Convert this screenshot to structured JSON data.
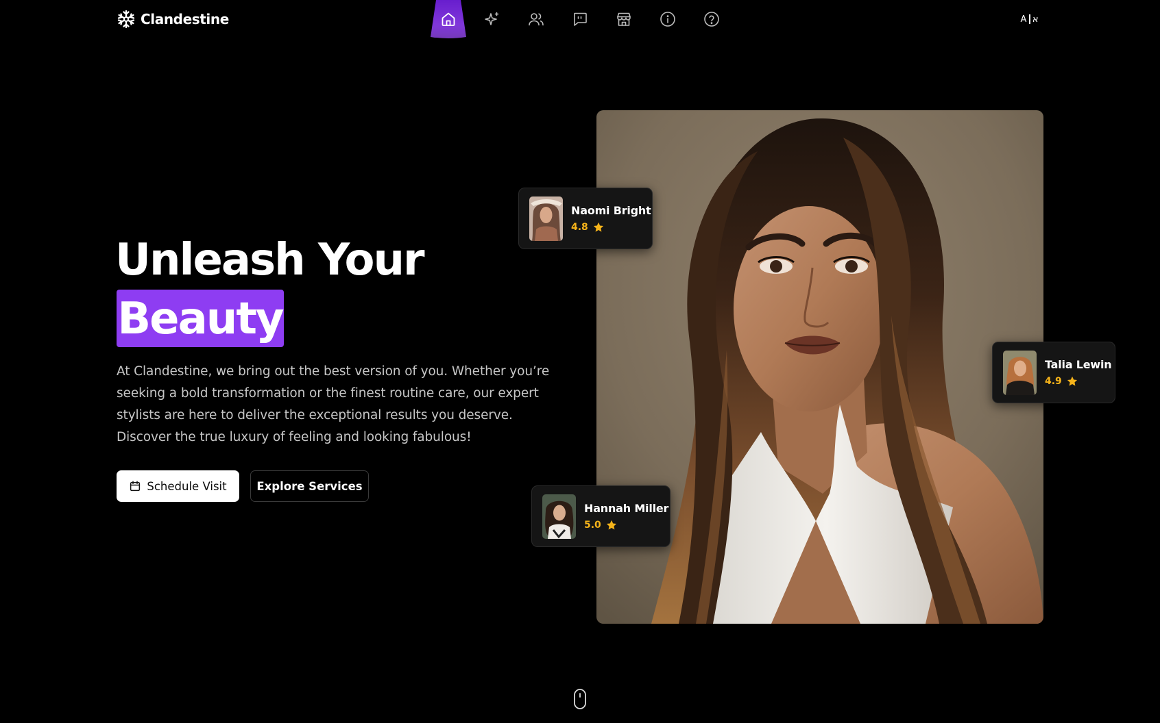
{
  "brand": {
    "name": "Clandestine",
    "logo_icon": "snowflake-icon"
  },
  "nav": {
    "active_index": 0,
    "accent_color": "#8e3df2",
    "items": [
      {
        "icon": "home-icon"
      },
      {
        "icon": "sparkles-icon"
      },
      {
        "icon": "users-icon"
      },
      {
        "icon": "quote-chat-icon"
      },
      {
        "icon": "store-icon"
      },
      {
        "icon": "info-icon"
      },
      {
        "icon": "help-icon"
      }
    ],
    "language_switch_left": "A",
    "language_switch_right": "א"
  },
  "hero": {
    "headline_line1": "Unleash Your",
    "headline_highlight": "Beauty",
    "highlight_color": "#8e3df2",
    "description": "At Clandestine, we bring out the best version of you. Whether you’re seeking a bold transformation or the finest routine care, our expert stylists are here to deliver the exceptional results you deserve. Discover the true luxury of feeling and looking fabulous!",
    "primary_button": {
      "label": "Schedule Visit",
      "icon": "calendar-icon"
    },
    "secondary_button": {
      "label": "Explore Services"
    }
  },
  "stylists": [
    {
      "name": "Naomi Bright",
      "rating": "4.8",
      "icon": "star-icon"
    },
    {
      "name": "Talia Lewin",
      "rating": "4.9",
      "icon": "star-icon"
    },
    {
      "name": "Hannah Miller",
      "rating": "5.0",
      "icon": "star-icon"
    }
  ],
  "rating_color": "#f5b31a",
  "scroll_hint_icon": "mouse-icon"
}
